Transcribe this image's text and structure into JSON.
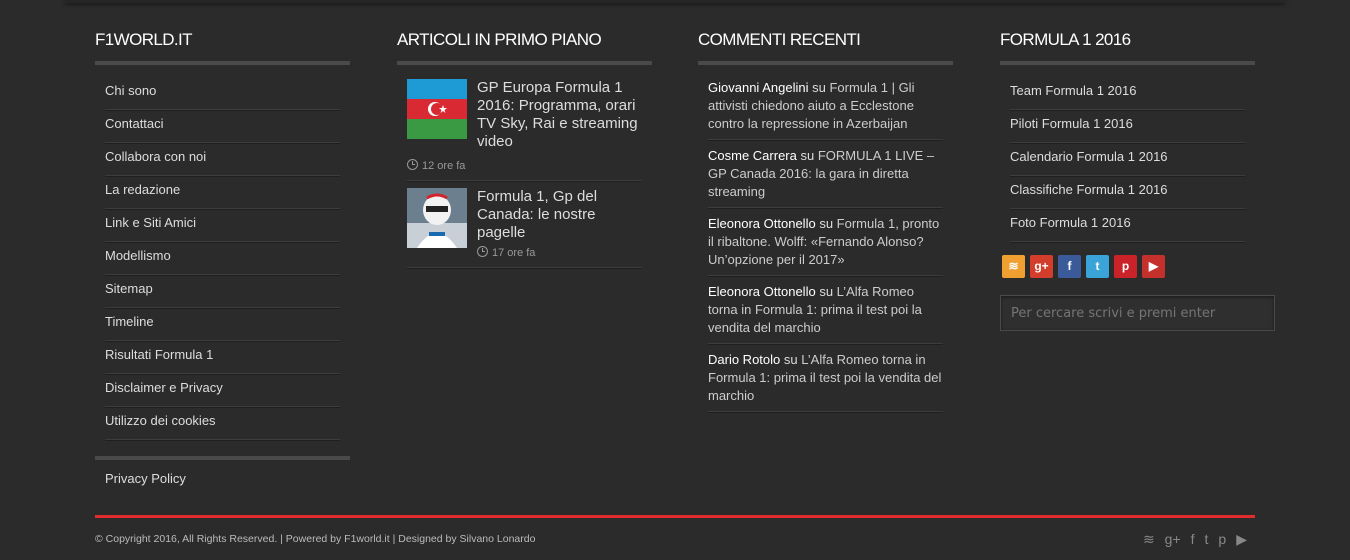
{
  "col1": {
    "title": "F1WORLD.IT",
    "items": [
      "Chi sono",
      "Contattaci",
      "Collabora con noi",
      "La redazione",
      "Link e Siti Amici",
      "Modellismo",
      "Sitemap",
      "Timeline",
      "Risultati Formula 1",
      "Disclaimer e Privacy",
      "Utilizzo dei cookies"
    ],
    "privacy": "Privacy Policy"
  },
  "col2": {
    "title": "ARTICOLI IN PRIMO PIANO",
    "posts": [
      {
        "title": "GP Europa Formula 1 2016: Programma, orari TV Sky, Rai e streaming video",
        "time": "12 ore fa"
      },
      {
        "title": "Formula 1, Gp del Canada: le nostre pagelle",
        "time": "17 ore fa"
      }
    ]
  },
  "col3": {
    "title": "COMMENTI RECENTI",
    "on": "su",
    "comments": [
      {
        "author": "Giovanni Angelini",
        "text": "Formula 1 | Gli attivisti chiedono aiuto a Ecclestone contro la repressione in Azerbaijan"
      },
      {
        "author": "Cosme Carrera",
        "text": "FORMULA 1 LIVE – GP Canada 2016: la gara in diretta streaming"
      },
      {
        "author": "Eleonora Ottonello",
        "text": "Formula 1, pronto il ribaltone. Wolff: «Fernando Alonso? Un’opzione per il 2017»"
      },
      {
        "author": "Eleonora Ottonello",
        "text": "L’Alfa Romeo torna in Formula 1: prima il test poi la vendita del marchio"
      },
      {
        "author": "Dario Rotolo",
        "text": "L’Alfa Romeo torna in Formula 1: prima il test poi la vendita del marchio"
      }
    ]
  },
  "col4": {
    "title": "FORMULA 1 2016",
    "items": [
      "Team Formula 1 2016",
      "Piloti Formula 1 2016",
      "Calendario Formula 1 2016",
      "Classifiche Formula 1 2016",
      "Foto Formula 1 2016"
    ],
    "social": [
      {
        "name": "rss-icon",
        "glyph": "≋",
        "color": "#f0a030"
      },
      {
        "name": "google-plus-icon",
        "glyph": "g+",
        "color": "#d23e2b"
      },
      {
        "name": "facebook-icon",
        "glyph": "f",
        "color": "#3b5a9a"
      },
      {
        "name": "twitter-icon",
        "glyph": "t",
        "color": "#3aa3d8"
      },
      {
        "name": "pinterest-icon",
        "glyph": "p",
        "color": "#c92228"
      },
      {
        "name": "youtube-icon",
        "glyph": "▶",
        "color": "#c4302b"
      }
    ],
    "search_placeholder": "Per cercare scrivi e premi enter"
  },
  "footer": {
    "text": "© Copyright 2016, All Rights Reserved. | Powered by F1world.it | Designed by Silvano Lonardo",
    "icons": [
      {
        "name": "rss-icon",
        "glyph": "≋"
      },
      {
        "name": "google-plus-icon",
        "glyph": "g+"
      },
      {
        "name": "facebook-icon",
        "glyph": "f"
      },
      {
        "name": "twitter-icon",
        "glyph": "t"
      },
      {
        "name": "pinterest-icon",
        "glyph": "p"
      },
      {
        "name": "youtube-icon",
        "glyph": "▶"
      }
    ]
  }
}
